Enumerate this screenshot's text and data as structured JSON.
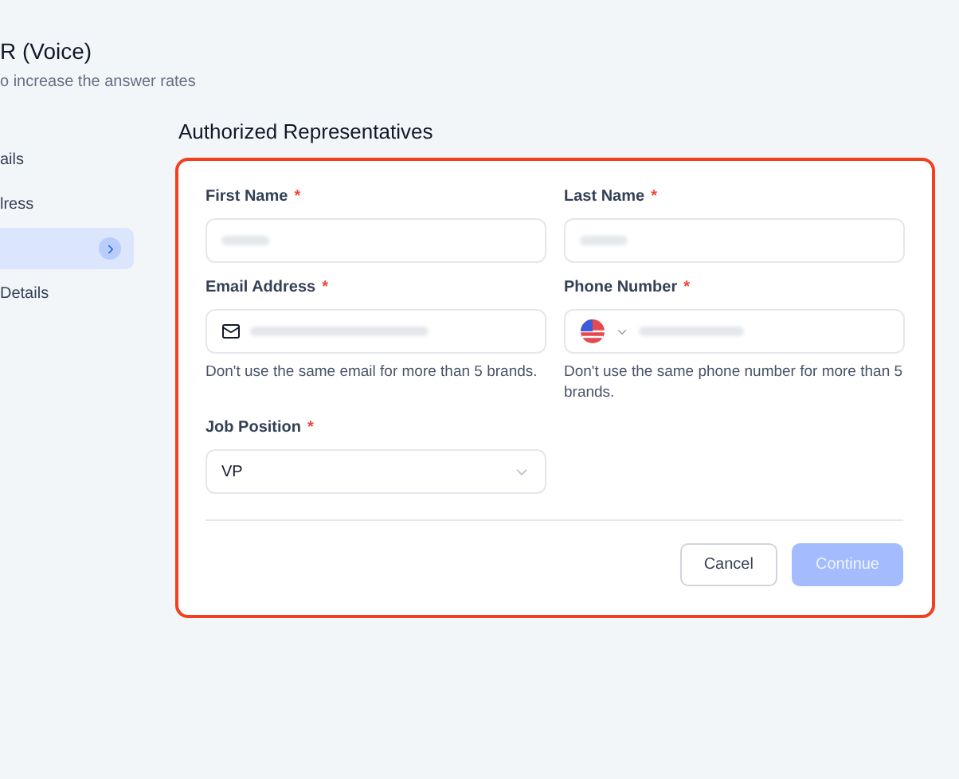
{
  "header": {
    "title": "R (Voice)",
    "subtitle": "o increase the answer rates"
  },
  "sidebar": {
    "items": [
      {
        "label": "ails",
        "selected": false
      },
      {
        "label": "lress",
        "selected": false
      },
      {
        "selected": true
      },
      {
        "label": "Details",
        "selected": false
      }
    ]
  },
  "section": {
    "title": "Authorized Representatives"
  },
  "form": {
    "highlighted": true,
    "fields": [
      {
        "kind": "text",
        "label": "First Name",
        "required": "*"
      },
      {
        "kind": "text",
        "label": "Last Name",
        "required": "*"
      },
      {
        "kind": "email",
        "label": "Email Address",
        "required": "*",
        "hint": "Don't use the same email for more than 5 brands."
      },
      {
        "kind": "phone",
        "label": "Phone Number",
        "required": "*",
        "hint": "Don't use the same phone number for more than 5 brands."
      },
      {
        "kind": "select",
        "label": "Job Position",
        "required": "*",
        "value": "VP"
      }
    ],
    "buttons": [
      {
        "label": "Cancel",
        "kind": "secondary"
      },
      {
        "label": "Continue",
        "kind": "primary",
        "disabled": true
      }
    ]
  }
}
